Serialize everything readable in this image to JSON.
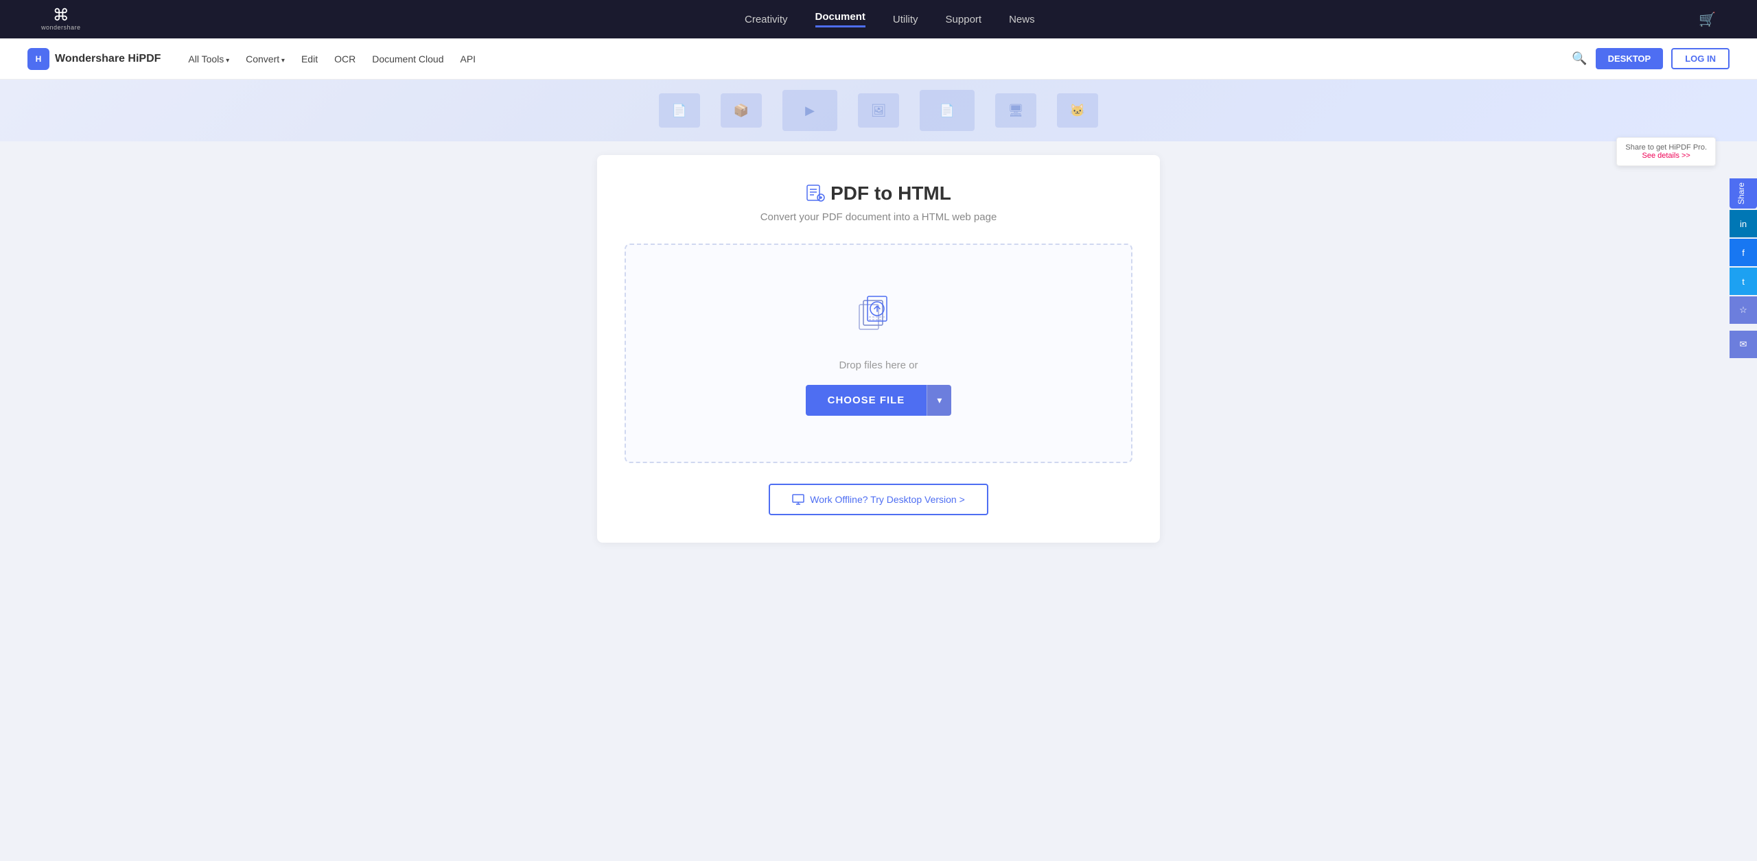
{
  "topNav": {
    "brand": "wondershare",
    "links": [
      {
        "label": "Creativity",
        "active": false
      },
      {
        "label": "Document",
        "active": true
      },
      {
        "label": "Utility",
        "active": false
      },
      {
        "label": "Support",
        "active": false
      },
      {
        "label": "News",
        "active": false
      }
    ]
  },
  "secNav": {
    "brand": "Wondershare HiPDF",
    "brandAbbr": "H",
    "links": [
      {
        "label": "All Tools",
        "hasArrow": true
      },
      {
        "label": "Convert",
        "hasArrow": true
      },
      {
        "label": "Edit",
        "hasArrow": false
      },
      {
        "label": "OCR",
        "hasArrow": false
      },
      {
        "label": "Document Cloud",
        "hasArrow": false
      },
      {
        "label": "API",
        "hasArrow": false
      }
    ],
    "desktopBtn": "DESKTOP",
    "loginBtn": "LOG IN"
  },
  "tool": {
    "title": "PDF to HTML",
    "subtitle": "Convert your PDF document into a HTML web page",
    "dropText": "Drop files here or",
    "chooseFileBtn": "CHOOSE FILE",
    "dropdownArrow": "▾",
    "desktopVersionBtn": "Work Offline? Try Desktop Version >"
  },
  "sharePromo": {
    "text": "Share to get HiPDF Pro.",
    "linkText": "See details >>",
    "shareLabel": "Share"
  },
  "social": {
    "linkedin": "in",
    "facebook": "f",
    "twitter": "t",
    "bookmark": "☆",
    "email": "✉"
  }
}
